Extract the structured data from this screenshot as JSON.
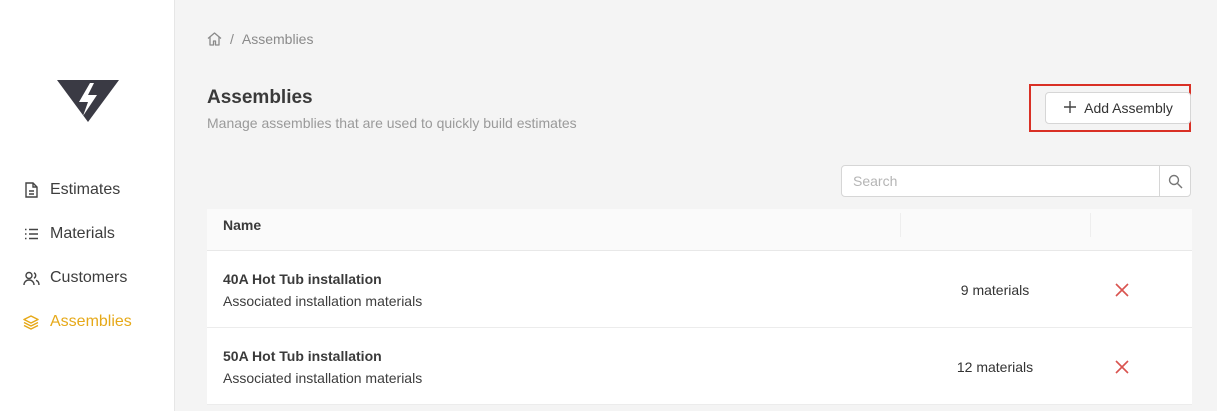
{
  "sidebar": {
    "items": [
      {
        "label": "Estimates",
        "icon": "document-icon"
      },
      {
        "label": "Materials",
        "icon": "list-icon"
      },
      {
        "label": "Customers",
        "icon": "users-icon"
      },
      {
        "label": "Assemblies",
        "icon": "layers-icon",
        "active": true
      }
    ]
  },
  "breadcrumb": {
    "separator": "/",
    "current": "Assemblies"
  },
  "header": {
    "title": "Assemblies",
    "subtitle": "Manage assemblies that are used to quickly build estimates",
    "add_button_label": "Add Assembly"
  },
  "search": {
    "placeholder": "Search",
    "value": ""
  },
  "table": {
    "columns": [
      "Name"
    ],
    "rows": [
      {
        "name": "40A Hot Tub installation",
        "description": "Associated installation materials",
        "materials": "9 materials"
      },
      {
        "name": "50A Hot Tub installation",
        "description": "Associated installation materials",
        "materials": "12 materials"
      }
    ]
  },
  "colors": {
    "accent": "#e6a919",
    "delete": "#d9534f",
    "highlight": "#d93025"
  }
}
